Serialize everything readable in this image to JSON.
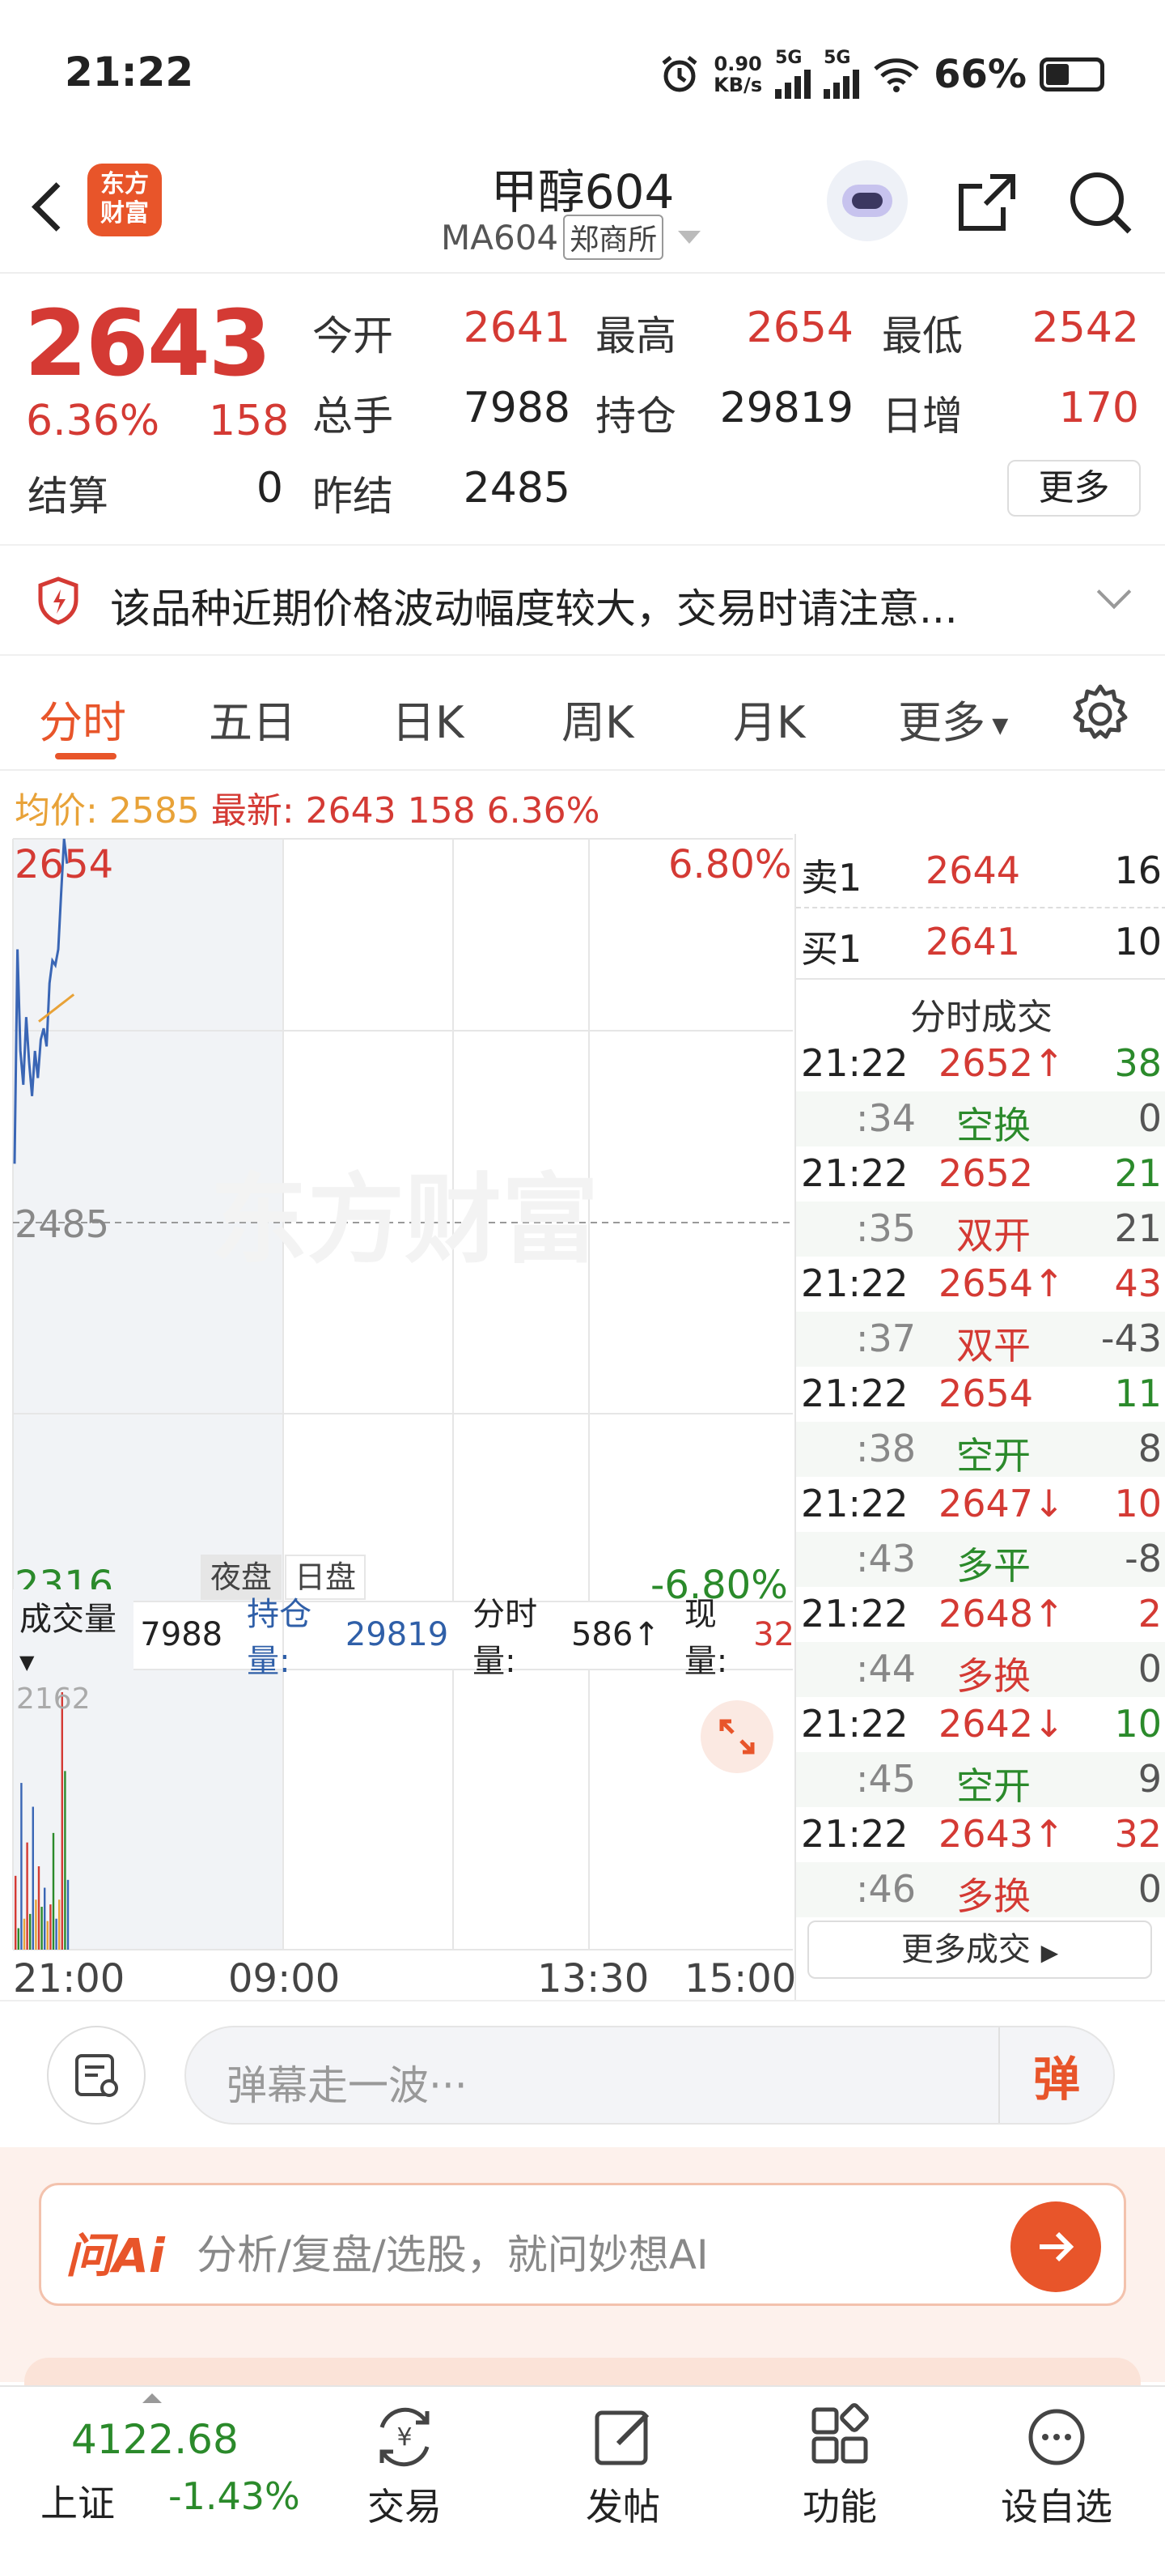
{
  "status_bar": {
    "time": "21:22",
    "net_speed_top": "0.90",
    "net_speed_unit": "KB/s",
    "sig1": "5G",
    "sig2": "5G",
    "battery": "66%"
  },
  "header": {
    "title": "甲醇604",
    "code": "MA604",
    "exchange": "郑商所",
    "logo_line1": "东方",
    "logo_line2": "财富"
  },
  "quote": {
    "price": "2643",
    "change_pct": "6.36%",
    "change": "158",
    "labels": {
      "open": "今开",
      "high": "最高",
      "low": "最低",
      "volume": "总手",
      "position": "持仓",
      "daily_inc": "日增",
      "settle": "结算",
      "prev_settle": "昨结"
    },
    "values": {
      "open": "2641",
      "high": "2654",
      "low": "2542",
      "volume": "7988",
      "position": "29819",
      "daily_inc": "170",
      "settle": "0",
      "prev_settle": "2485"
    },
    "more": "更多"
  },
  "notice": {
    "text": "该品种近期价格波动幅度较大，交易时请注意..."
  },
  "tabs": [
    "分时",
    "五日",
    "日K",
    "周K",
    "月K",
    "更多"
  ],
  "info_line": {
    "avg_label": "均价:",
    "avg_value": "2585",
    "latest_label": "最新:",
    "latest_value": "2643",
    "latest_change": "158",
    "latest_pct": "6.36%"
  },
  "chart": {
    "y_top": "2654",
    "y_mid": "2485",
    "y_bottom": "2316",
    "pct_top": "6.80%",
    "pct_bottom": "-6.80%",
    "session_night": "夜盘",
    "session_day": "日盘",
    "watermark": "东方财富",
    "vol_label": "成交量",
    "vol_value": "7988",
    "oi_label": "持仓量:",
    "oi_value": "29819",
    "tick_vol_label": "分时量:",
    "tick_vol_value": "586↑",
    "cur_vol_label": "现量:",
    "cur_vol_value": "32",
    "vol_max": "2162",
    "x_labels": [
      "21:00",
      "09:00",
      "13:30",
      "15:00"
    ]
  },
  "chart_data": {
    "type": "line",
    "title": "",
    "series": [
      {
        "values": [
          2510,
          2605,
          2560,
          2545,
          2575,
          2555,
          2540,
          2560,
          2548,
          2565,
          2570,
          2562,
          2590,
          2600,
          2598,
          2605,
          2630,
          2654,
          2643
        ]
      },
      {
        "values": [
          2573,
          2574,
          2575,
          2576,
          2577,
          2578,
          2579,
          2580,
          2581,
          2582,
          2583,
          2584,
          2585
        ]
      }
    ],
    "volume": [
      620,
      180,
      1400,
      260,
      900,
      300,
      1200,
      420,
      700,
      360,
      520,
      240,
      380,
      980,
      260,
      420,
      2162,
      1500,
      586
    ],
    "ylim": [
      2316,
      2654
    ],
    "grid": true
  },
  "orderbook": {
    "sell_label": "卖1",
    "sell_price": "2644",
    "sell_vol": "16",
    "buy_label": "买1",
    "buy_price": "2641",
    "buy_vol": "10"
  },
  "trades_title": "分时成交",
  "trades": [
    {
      "time": "21:22",
      "price": "2652↑",
      "vol": "38",
      "sec": ":34",
      "type": "空换",
      "oi": "0",
      "pc": "red",
      "vc": "green",
      "tc": "green",
      "oc": "gray"
    },
    {
      "time": "21:22",
      "price": "2652",
      "vol": "21",
      "sec": ":35",
      "type": "双开",
      "oi": "21",
      "pc": "red",
      "vc": "green",
      "tc": "red",
      "oc": "gray"
    },
    {
      "time": "21:22",
      "price": "2654↑",
      "vol": "43",
      "sec": ":37",
      "type": "双平",
      "oi": "-43",
      "pc": "red",
      "vc": "red",
      "tc": "red",
      "oc": "gray"
    },
    {
      "time": "21:22",
      "price": "2654",
      "vol": "11",
      "sec": ":38",
      "type": "空开",
      "oi": "8",
      "pc": "red",
      "vc": "green",
      "tc": "green",
      "oc": "gray"
    },
    {
      "time": "21:22",
      "price": "2647↓",
      "vol": "10",
      "sec": ":43",
      "type": "多平",
      "oi": "-8",
      "pc": "red",
      "vc": "red",
      "tc": "green",
      "oc": "gray"
    },
    {
      "time": "21:22",
      "price": "2648↑",
      "vol": "2",
      "sec": ":44",
      "type": "多换",
      "oi": "0",
      "pc": "red",
      "vc": "red",
      "tc": "red",
      "oc": "gray"
    },
    {
      "time": "21:22",
      "price": "2642↓",
      "vol": "10",
      "sec": ":45",
      "type": "空开",
      "oi": "9",
      "pc": "red",
      "vc": "green",
      "tc": "green",
      "oc": "gray"
    },
    {
      "time": "21:22",
      "price": "2643↑",
      "vol": "32",
      "sec": ":46",
      "type": "多换",
      "oi": "0",
      "pc": "red",
      "vc": "red",
      "tc": "red",
      "oc": "gray"
    }
  ],
  "more_trades": "更多成交",
  "comment": {
    "placeholder": "弹幕走一波···",
    "danmu": "弹"
  },
  "ai": {
    "logo": "问Ai",
    "text": "分析/复盘/选股，就问妙想AI"
  },
  "bottom_nav": {
    "index_value": "4122.68",
    "index_name": "上证",
    "index_pct": "-1.43%",
    "items": [
      "交易",
      "发帖",
      "功能",
      "设自选"
    ]
  }
}
